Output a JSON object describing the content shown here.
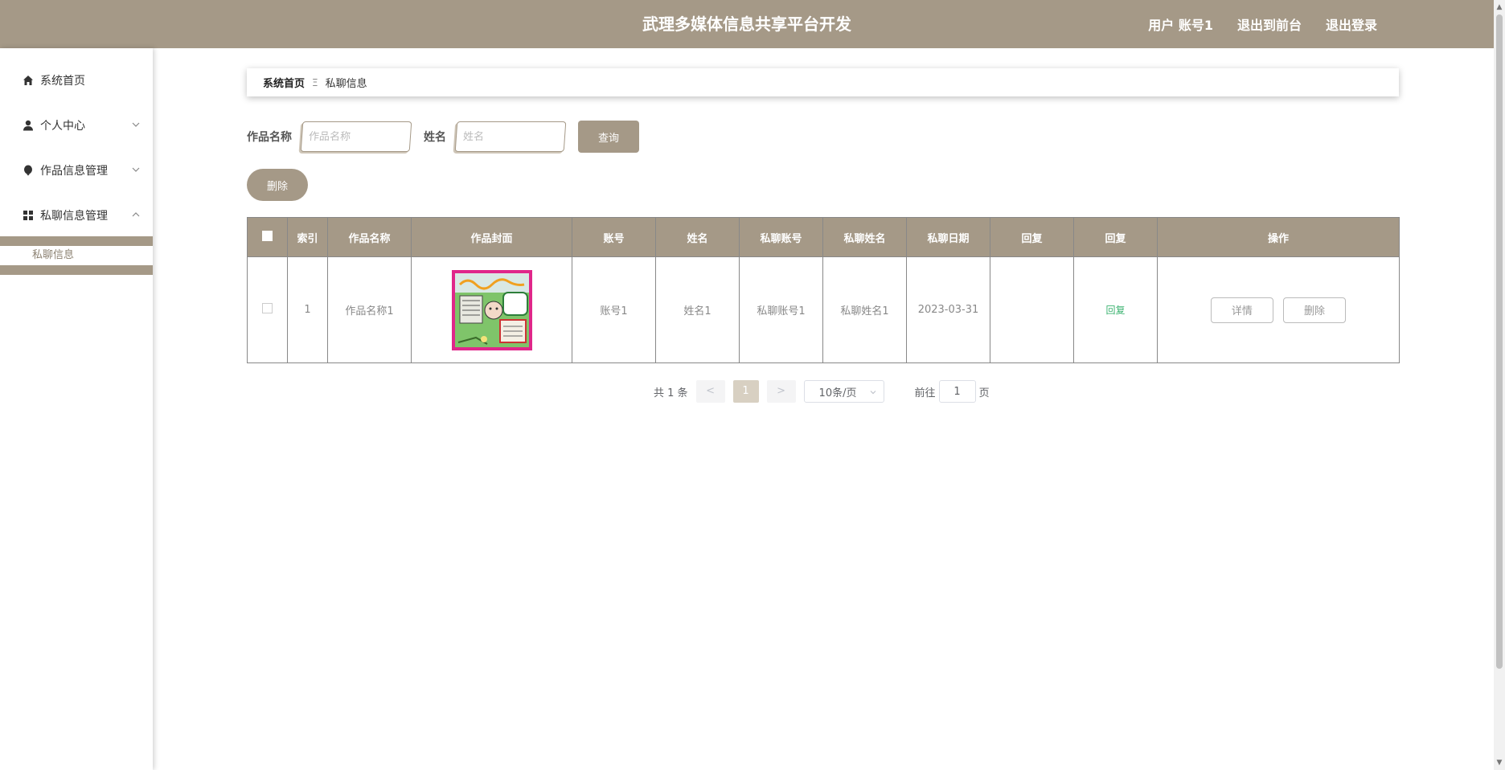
{
  "header": {
    "title": "武理多媒体信息共享平台开发",
    "user_label": "用户 账号1",
    "front_label": "退出到前台",
    "logout_label": "退出登录"
  },
  "sidebar": {
    "items": [
      {
        "label": "系统首页",
        "icon": "home-icon"
      },
      {
        "label": "个人中心",
        "icon": "user-icon",
        "arrow": "down"
      },
      {
        "label": "作品信息管理",
        "icon": "balloon-icon",
        "arrow": "down"
      },
      {
        "label": "私聊信息管理",
        "icon": "grid-icon",
        "arrow": "up"
      }
    ],
    "submenu": {
      "label": "私聊信息"
    }
  },
  "breadcrumb": {
    "home": "系统首页",
    "separator": "Ξ",
    "current": "私聊信息"
  },
  "search": {
    "field1_label": "作品名称",
    "field1_placeholder": "作品名称",
    "field2_label": "姓名",
    "field2_placeholder": "姓名",
    "query_label": "查询"
  },
  "actions": {
    "delete_label": "删除"
  },
  "table": {
    "columns": [
      "索引",
      "作品名称",
      "作品封面",
      "账号",
      "姓名",
      "私聊账号",
      "私聊姓名",
      "私聊日期",
      "回复",
      "回复",
      "操作"
    ],
    "rows": [
      {
        "index": "1",
        "work_name": "作品名称1",
        "account": "账号1",
        "name": "姓名1",
        "chat_account": "私聊账号1",
        "chat_name": "私聊姓名1",
        "date": "2023-03-31",
        "reply_text": "",
        "reply_link": "回复",
        "detail_label": "详情",
        "delete_label": "删除"
      }
    ]
  },
  "pagination": {
    "total": "共 1 条",
    "prev": "<",
    "current_page": "1",
    "next": ">",
    "page_size": "10条/页",
    "goto_label": "前往",
    "goto_value": "1",
    "page_suffix": "页"
  },
  "colors": {
    "accent": "#a59987",
    "reply": "#3cb371"
  }
}
